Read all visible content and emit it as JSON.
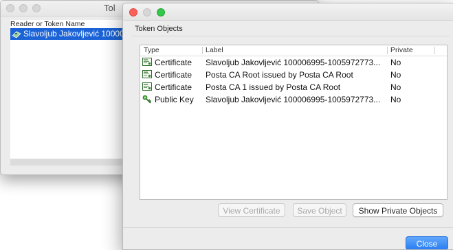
{
  "back_window": {
    "title": "Tol",
    "column_header": "Reader or Token Name",
    "selected_row": "Slavoljub Jakovljević 10000"
  },
  "front_window": {
    "section_label": "Token Objects",
    "table": {
      "columns": [
        "Type",
        "Label",
        "Private"
      ],
      "rows": [
        {
          "type": "Certificate",
          "label": "Slavoljub Jakovljević 100006995-1005972773...",
          "private": "No",
          "icon": "certificate-icon"
        },
        {
          "type": "Certificate",
          "label": "Posta CA Root issued by Posta CA Root",
          "private": "No",
          "icon": "certificate-icon"
        },
        {
          "type": "Certificate",
          "label": "Posta CA 1 issued by Posta CA Root",
          "private": "No",
          "icon": "certificate-icon"
        },
        {
          "type": "Public Key",
          "label": "Slavoljub Jakovljević 100006995-1005972773...",
          "private": "No",
          "icon": "key-icon"
        }
      ]
    },
    "buttons": {
      "view_certificate": "View Certificate",
      "save_object": "Save Object",
      "show_private_objects": "Show Private Objects",
      "close": "Close"
    }
  },
  "colors": {
    "selection": "#1b63d6",
    "primary_button": "#2a7ef3",
    "close_dot": "#fc605b",
    "zoom_dot": "#34c84a"
  }
}
